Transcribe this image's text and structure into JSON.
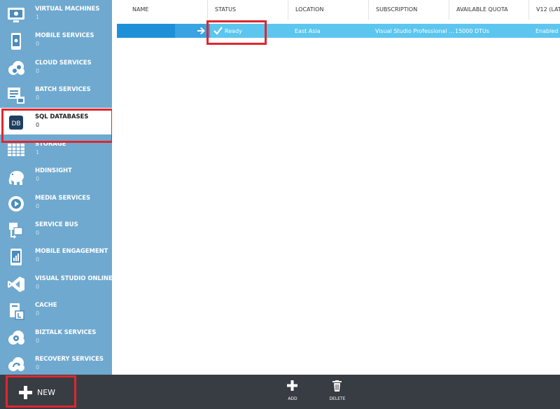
{
  "sidebar": {
    "items": [
      {
        "label": "VIRTUAL MACHINES",
        "count": "1",
        "icon": "monitor-icon"
      },
      {
        "label": "MOBILE SERVICES",
        "count": "0",
        "icon": "mobile-icon"
      },
      {
        "label": "CLOUD SERVICES",
        "count": "0",
        "icon": "cloud-gear-icon"
      },
      {
        "label": "BATCH SERVICES",
        "count": "0",
        "icon": "batch-icon"
      },
      {
        "label": "SQL DATABASES",
        "count": "0",
        "icon": "database-icon",
        "selected": true
      },
      {
        "label": "STORAGE",
        "count": "1",
        "icon": "storage-grid-icon"
      },
      {
        "label": "HDINSIGHT",
        "count": "0",
        "icon": "elephant-icon"
      },
      {
        "label": "MEDIA SERVICES",
        "count": "0",
        "icon": "media-play-icon"
      },
      {
        "label": "SERVICE BUS",
        "count": "0",
        "icon": "service-bus-icon"
      },
      {
        "label": "MOBILE ENGAGEMENT",
        "count": "0",
        "icon": "mobile-chart-icon"
      },
      {
        "label": "VISUAL STUDIO ONLINE",
        "count": "0",
        "icon": "visual-studio-icon"
      },
      {
        "label": "CACHE",
        "count": "0",
        "icon": "cache-icon"
      },
      {
        "label": "BIZTALK SERVICES",
        "count": "0",
        "icon": "biztalk-icon"
      },
      {
        "label": "RECOVERY SERVICES",
        "count": "0",
        "icon": "recovery-cloud-icon"
      }
    ],
    "db_icon_text": "DB"
  },
  "table": {
    "columns": [
      "NAME",
      "STATUS",
      "LOCATION",
      "SUBSCRIPTION",
      "AVAILABLE QUOTA",
      "V12 (LAT"
    ],
    "rows": [
      {
        "name": "",
        "status": "Ready",
        "location": "East Asia",
        "subscription": "Visual Studio Professional ...",
        "quota": "15000 DTUs",
        "v12": "Enabled"
      }
    ]
  },
  "bottombar": {
    "new_label": "NEW",
    "tools": [
      {
        "label": "ADD",
        "icon": "plus-icon"
      },
      {
        "label": "DELETE",
        "icon": "trash-icon"
      }
    ]
  },
  "colors": {
    "sidebar": "#6fa9cf",
    "row": "#5dc6ef",
    "row_accent": "#1e90d7",
    "bottombar": "#383d43",
    "highlight": "#e0262e"
  }
}
